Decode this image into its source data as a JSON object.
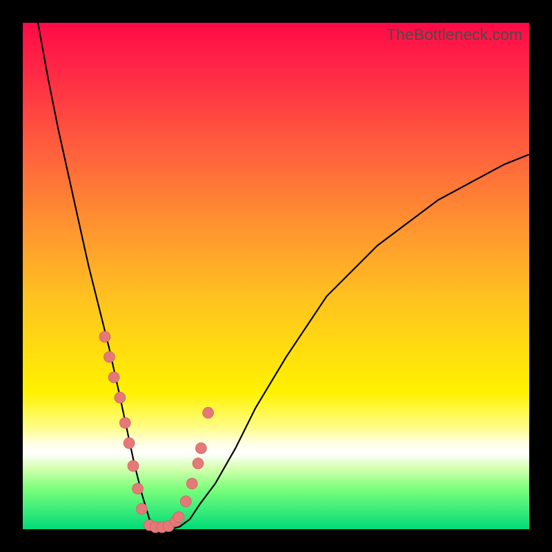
{
  "watermark": "TheBottleneck.com",
  "colors": {
    "background_frame": "#000000",
    "gradient_top": "#ff0a47",
    "gradient_mid": "#ffe600",
    "gradient_bottom": "#00db77",
    "curve": "#000000",
    "dot_fill": "#e57878",
    "dot_stroke": "#c95a5a"
  },
  "chart_data": {
    "type": "line",
    "title": "",
    "xlabel": "",
    "ylabel": "",
    "xlim": [
      0,
      100
    ],
    "ylim": [
      0,
      100
    ],
    "series": [
      {
        "name": "bottleneck-curve",
        "x": [
          3,
          5,
          7,
          9,
          11,
          13,
          15,
          17,
          19,
          20.5,
          22,
          23.5,
          25,
          27,
          29,
          31,
          33,
          35,
          38,
          42,
          46,
          52,
          60,
          70,
          82,
          95,
          100
        ],
        "y": [
          100,
          89,
          79,
          70,
          61,
          52,
          44,
          36,
          27,
          20,
          13,
          7,
          2,
          0,
          0,
          0.5,
          2,
          5,
          9,
          16,
          24,
          34,
          46,
          56,
          65,
          72,
          74
        ]
      }
    ],
    "marker_points": {
      "name": "highlighted-dots",
      "x": [
        16.2,
        17.1,
        18.0,
        19.2,
        20.2,
        21.0,
        21.8,
        22.7,
        23.5,
        25.0,
        26.2,
        27.5,
        28.8,
        30.2,
        30.8,
        32.2,
        33.4,
        34.6,
        35.2,
        36.6
      ],
      "y": [
        38,
        34,
        30,
        26,
        21,
        17,
        12.5,
        8,
        4,
        0.8,
        0.4,
        0.4,
        0.6,
        1.6,
        2.4,
        5.5,
        9,
        13,
        16,
        23
      ]
    }
  }
}
